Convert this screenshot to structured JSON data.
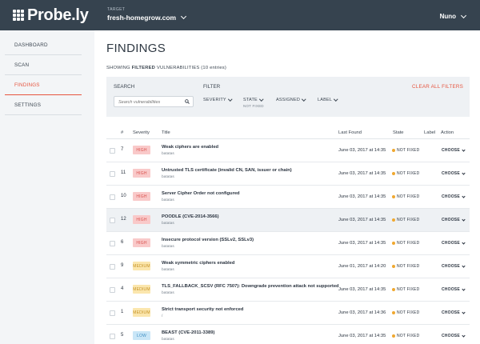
{
  "app": {
    "logo_text": "Probe.ly"
  },
  "header": {
    "target_label": "TARGET",
    "target_value": "fresh-homegrow.com",
    "user": "Nuno"
  },
  "sidebar": {
    "items": [
      {
        "label": "DASHBOARD",
        "active": false
      },
      {
        "label": "SCAN",
        "active": false
      },
      {
        "label": "FINDINGS",
        "active": true
      },
      {
        "label": "SETTINGS",
        "active": false
      }
    ]
  },
  "main": {
    "title": "FINDINGS",
    "showing_prefix": "SHOWING",
    "showing_bold": "FILTERED",
    "showing_suffix": "VULNERABILITIES (10 entries)"
  },
  "filters": {
    "search_label": "SEARCH",
    "filter_label": "FILTER",
    "clear_label": "CLEAR ALL FILTERS",
    "search_placeholder": "Search vulnerabilities",
    "severity_label": "SEVERITY",
    "state_label": "STATE",
    "state_value": "NOT FIXED",
    "assigned_label": "ASSIGNED",
    "label_label": "LABEL"
  },
  "table": {
    "columns": {
      "num": "#",
      "severity": "Severity",
      "title": "Title",
      "last_found": "Last Found",
      "state": "State",
      "label": "Label",
      "action": "Action"
    },
    "rows": [
      {
        "num": "7",
        "severity": "HIGH",
        "title": "Weak ciphers are enabled",
        "subtitle": "batatas",
        "last_found": "June 03, 2017 at 14:35",
        "state": "NOT FIXED",
        "action": "CHOOSE"
      },
      {
        "num": "11",
        "severity": "HIGH",
        "title": "Untrusted TLS certificate (invalid CN, SAN, issuer or chain)",
        "subtitle": "batatas",
        "last_found": "June 03, 2017 at 14:35",
        "state": "NOT FIXED",
        "action": "CHOOSE"
      },
      {
        "num": "10",
        "severity": "HIGH",
        "title": "Server Cipher Order not configured",
        "subtitle": "batatas",
        "last_found": "June 03, 2017 at 14:35",
        "state": "NOT FIXED",
        "action": "CHOOSE"
      },
      {
        "num": "12",
        "severity": "HIGH",
        "title": "POODLE (CVE-2014-3566)",
        "subtitle": "batatas",
        "last_found": "June 03, 2017 at 14:35",
        "state": "NOT FIXED",
        "action": "CHOOSE"
      },
      {
        "num": "6",
        "severity": "HIGH",
        "title": "Insecure protocol version (SSLv2, SSLv3)",
        "subtitle": "batatas",
        "last_found": "June 03, 2017 at 14:35",
        "state": "NOT FIXED",
        "action": "CHOOSE"
      },
      {
        "num": "9",
        "severity": "MEDIUM",
        "title": "Weak symmetric ciphers enabled",
        "subtitle": "batatas",
        "last_found": "June 01, 2017 at 14:20",
        "state": "NOT FIXED",
        "action": "CHOOSE"
      },
      {
        "num": "4",
        "severity": "MEDIUM",
        "title": "TLS_FALLBACK_SCSV (RFC 7507): Downgrade prevention attack not supported",
        "subtitle": "batatas",
        "last_found": "June 03, 2017 at 14:35",
        "state": "NOT FIXED",
        "action": "CHOOSE"
      },
      {
        "num": "1",
        "severity": "MEDIUM",
        "title": "Strict transport security not enforced",
        "subtitle": "/",
        "last_found": "June 03, 2017 at 14:36",
        "state": "NOT FIXED",
        "action": "CHOOSE"
      },
      {
        "num": "5",
        "severity": "LOW",
        "title": "BEAST (CVE-2011-3389)",
        "subtitle": "batatas",
        "last_found": "June 03, 2017 at 14:35",
        "state": "NOT FIXED",
        "action": "CHOOSE"
      }
    ]
  },
  "colors": {
    "topbar": "#36434f",
    "accent": "#e6553f",
    "high": "#f9c9c9",
    "medium": "#fbe6ad",
    "low": "#c9e6f7",
    "state_dot": "#f0a830"
  },
  "icons": {
    "logo": "grid-dots-icon",
    "search": "search-icon",
    "dropdown": "chevron-down-icon",
    "state": "status-dot-icon"
  }
}
